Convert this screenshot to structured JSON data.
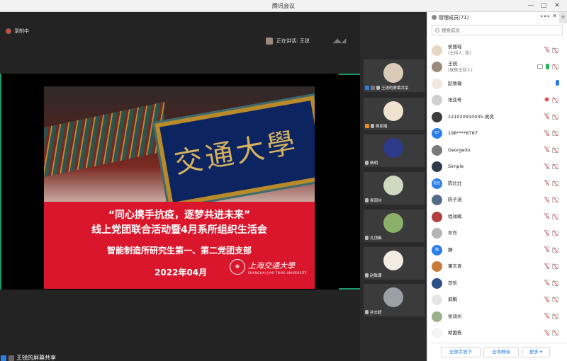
{
  "window": {
    "title": "腾讯会议",
    "controls": [
      "—",
      "▢",
      "✕"
    ]
  },
  "meeting": {
    "recording_label": "录制中",
    "speaking_label": "正在讲话: 王锐",
    "share_label": "王锐的屏幕共享"
  },
  "slide": {
    "plaque_text": "交通大學",
    "line1": "“同心携手抗疫，逐梦共进未来”",
    "line2": "线上党团联合活动暨4月系所组织生活会",
    "line3": "智能制造所研究生第一、第二党团支部",
    "date": "2022年04月",
    "logo_cn": "上海交通大學",
    "logo_en": "SHANGHAI JIAO TONG UNIVERSITY"
  },
  "video_tiles": [
    {
      "label": "王锐的屏幕共享",
      "color": "#d9cbb8",
      "icon": "screen-share-icon"
    },
    {
      "label": "侯丽瑶",
      "color": "#efe3d0",
      "icon": "screen-share-icon"
    },
    {
      "label": "杨明",
      "color": "#2e3a8a",
      "icon": "mic-icon"
    },
    {
      "label": "侯润州",
      "color": "#cfd9c2",
      "icon": "mic-icon"
    },
    {
      "label": "孔顶雍",
      "color": "#8bb06a",
      "icon": "mic-icon"
    },
    {
      "label": "赵致珊",
      "color": "#f2ece3",
      "icon": "mic-icon"
    },
    {
      "label": "孙志超",
      "color": "#9aa0a6",
      "icon": "mic-icon"
    }
  ],
  "panel": {
    "title": "管理成员(71)",
    "search_placeholder": "搜索成员",
    "members": [
      {
        "name": "侯丽瑶",
        "sub": "(主持人, 我)",
        "avatar": "#e7d6c2",
        "icons": [
          "mic-off",
          "cam-off"
        ]
      },
      {
        "name": "王锐",
        "sub": "(联席主持人)",
        "avatar": "#9a8a7a",
        "icons": [
          "screen",
          "mic-on",
          "cam-off"
        ]
      },
      {
        "name": "赵致珊",
        "sub": "",
        "avatar": "#f1e9e0",
        "icons": [
          "mic-blue"
        ]
      },
      {
        "name": "张亚奇",
        "sub": "",
        "avatar": "#cfcfcf",
        "icons": [
          "rec",
          "cam-off"
        ]
      },
      {
        "name": "121020910035-吴昊",
        "sub": "",
        "avatar": "#3d3d3d",
        "icons": [
          "mic-off",
          "cam-off"
        ]
      },
      {
        "name": "198****8767",
        "sub": "",
        "avatar": "#2b7de9",
        "avatar_text": "67",
        "icons": [
          "mic-off",
          "cam-off"
        ]
      },
      {
        "name": "GeorgeXx",
        "sub": "",
        "avatar": "#7a7a7a",
        "icons": [
          "mic-off",
          "cam-off"
        ]
      },
      {
        "name": "Simple",
        "sub": "",
        "avatar": "#2f3a4a",
        "icons": [
          "mic-off",
          "cam-off"
        ]
      },
      {
        "name": "陈灶灶",
        "sub": "",
        "avatar": "#2b7de9",
        "avatar_text": "灶灶",
        "icons": [
          "mic-off",
          "cam-off"
        ]
      },
      {
        "name": "陈子涵",
        "sub": "",
        "avatar": "#556b88",
        "icons": [
          "mic-off",
          "cam-off"
        ]
      },
      {
        "name": "程祥辉",
        "sub": "",
        "avatar": "#b34040",
        "icons": [
          "mic-off",
          "cam-off"
        ]
      },
      {
        "name": "邓肖",
        "sub": "",
        "avatar": "#b5b5b5",
        "icons": [
          "mic-off",
          "cam-off"
        ]
      },
      {
        "name": "䴉",
        "sub": "",
        "avatar": "#2b7de9",
        "avatar_text": "䴉",
        "icons": [
          "mic-off",
          "cam-off"
        ]
      },
      {
        "name": "董言真",
        "sub": "",
        "avatar": "#c77a3a",
        "icons": [
          "mic-off",
          "cam-off"
        ]
      },
      {
        "name": "范哲",
        "sub": "",
        "avatar": "#2d4f8a",
        "icons": [
          "mic-off",
          "cam-off"
        ]
      },
      {
        "name": "郭鹏",
        "sub": "",
        "avatar": "#e5e5e5",
        "icons": [
          "mic-off",
          "cam-off"
        ]
      },
      {
        "name": "侯润州",
        "sub": "",
        "avatar": "#9cb08a",
        "icons": [
          "mic-off",
          "cam-off"
        ]
      },
      {
        "name": "胡国栋",
        "sub": "",
        "avatar": "#f4f4f4",
        "icons": [
          "mic-off",
          "cam-off"
        ]
      }
    ],
    "footer": {
      "mute_all_hands": "全部手放下",
      "mute_all": "全体静音",
      "more": "更多 ▾"
    }
  },
  "colors": {
    "accent": "#2b7de9",
    "share_border": "#1b9a6c",
    "slide_red": "#d9162c"
  }
}
